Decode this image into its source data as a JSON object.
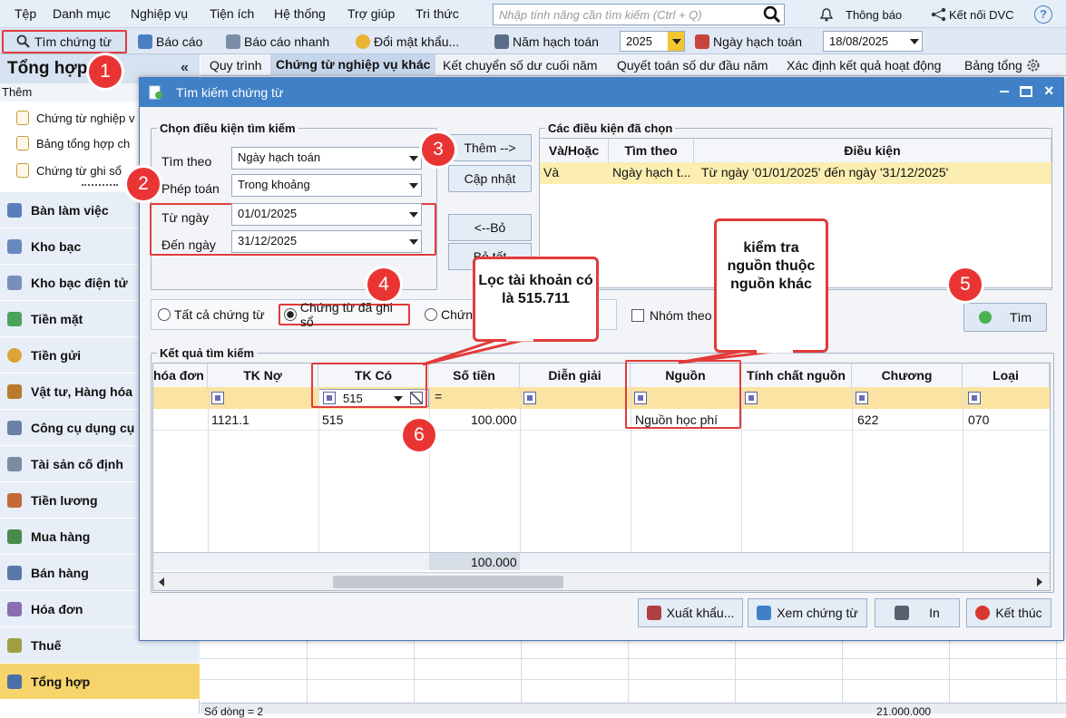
{
  "menu": [
    "Tệp",
    "Danh mục",
    "Nghiệp vụ",
    "Tiện ích",
    "Hệ thống",
    "Trợ giúp",
    "Tri thức"
  ],
  "search": {
    "placeholder": "Nhập tính năng cần tìm kiếm (Ctrl + Q)"
  },
  "topright": {
    "notify": "Thông báo",
    "connect": "Kết nối DVC",
    "help": "?"
  },
  "toolbar": {
    "find_voucher": "Tìm chứng từ",
    "report": "Báo cáo",
    "quick_report": "Báo cáo nhanh",
    "change_pw": "Đổi mật khẩu...",
    "fiscal_year_label": "Năm hạch toán",
    "fiscal_year": "2025",
    "posting_date_label": "Ngày hạch toán",
    "posting_date": "18/08/2025"
  },
  "left": {
    "title": "Tổng hợp",
    "collapse": "«",
    "sub_header": "Thêm",
    "sub_items": [
      "Chứng từ nghiệp v",
      "Bảng tổng hợp ch",
      "Chứng từ ghi sổ"
    ],
    "nav": [
      "Bàn làm việc",
      "Kho bạc",
      "Kho bạc điện tử",
      "Tiền mặt",
      "Tiền gửi",
      "Vật tư, Hàng hóa",
      "Công cụ dụng cụ",
      "Tài sản cố định",
      "Tiền lương",
      "Mua hàng",
      "Bán hàng",
      "Hóa đơn",
      "Thuế",
      "Tổng hợp"
    ]
  },
  "tabs": [
    "Quy trình",
    "Chứng từ nghiệp vụ khác",
    "Kết chuyển số dư cuối năm",
    "Quyết toán số dư đầu năm",
    "Xác định kết quả hoạt động",
    "Bảng tổng"
  ],
  "dialog": {
    "title": "Tìm kiếm chứng từ",
    "criteria": {
      "legend": "Chọn điều kiện tìm kiếm",
      "search_by_label": "Tìm theo",
      "search_by": "Ngày hạch toán",
      "op_label": "Phép toán",
      "op": "Trong khoảng",
      "from_label": "Từ ngày",
      "from": "01/01/2025",
      "to_label": "Đến ngày",
      "to": "31/12/2025"
    },
    "buttons": {
      "add": "Thêm -->",
      "update": "Cập nhật",
      "remove": "<--Bỏ",
      "clear": "Bỏ tất",
      "find": "Tìm",
      "export": "Xuất khẩu...",
      "view": "Xem chứng từ",
      "print": "In",
      "close": "Kết thúc"
    },
    "selected": {
      "legend": "Các điều kiện đã chọn",
      "headers": [
        "Và/Hoặc",
        "Tìm theo",
        "Điều kiện"
      ],
      "row": [
        "Và",
        "Ngày hạch t...",
        "Từ ngày '01/01/2025' đến ngày '31/12/2025'"
      ]
    },
    "radios": [
      "Tất cả chứng từ",
      "Chứng từ đã ghi sổ",
      "Chứng từ chưa ghi sổ"
    ],
    "group_label": "Nhóm theo",
    "results": {
      "legend": "Kết quả tìm kiếm",
      "headers": [
        "hóa đơn",
        "TK Nợ",
        "TK Có",
        "Số tiền",
        "Diễn giải",
        "Nguồn",
        "Tính chất nguồn",
        "Chương",
        "Loại"
      ],
      "filter_tkco": "515",
      "filter_eq": "=",
      "row": {
        "tkno": "1121.1",
        "tkco": "515",
        "amount": "100.000",
        "source": "Nguồn học phí",
        "chapter": "622",
        "type": "070"
      },
      "total": "100.000"
    }
  },
  "callouts": {
    "filter": "Lọc tài khoản có là 515.711",
    "check": "kiểm tra nguồn thuộc nguồn khác"
  },
  "badges": [
    "1",
    "2",
    "3",
    "4",
    "5",
    "6"
  ],
  "status": {
    "count": "Số dòng = 2",
    "sum": "21.000.000"
  }
}
